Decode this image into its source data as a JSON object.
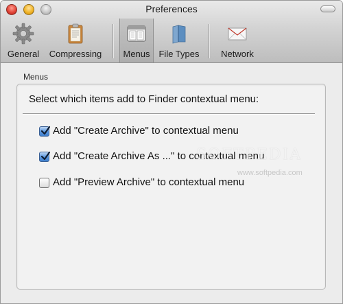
{
  "window": {
    "title": "Preferences"
  },
  "toolbar": {
    "items": [
      {
        "label": "General",
        "icon": "gear-icon",
        "selected": false
      },
      {
        "label": "Compressing",
        "icon": "clipboard-icon",
        "selected": false
      },
      {
        "label": "Menus",
        "icon": "menu-window-icon",
        "selected": true
      },
      {
        "label": "File Types",
        "icon": "folder-icon",
        "selected": false
      },
      {
        "label": "Network",
        "icon": "envelope-icon",
        "selected": false
      }
    ]
  },
  "menus_panel": {
    "group_label": "Menus",
    "heading": "Select which items add to Finder contextual menu:",
    "options": [
      {
        "label": "Add \"Create Archive\" to contextual menu",
        "checked": true
      },
      {
        "label": "Add \"Create Archive As ...\" to contextual menu",
        "checked": true
      },
      {
        "label": "Add \"Preview Archive\" to contextual menu",
        "checked": false
      }
    ]
  },
  "watermark": {
    "text": "SOFTPEDIA",
    "url": "www.softpedia.com"
  },
  "colors": {
    "checkbox_checked": "#5d98de",
    "close_button": "#e2463a",
    "minimize_button": "#f1b52a"
  }
}
